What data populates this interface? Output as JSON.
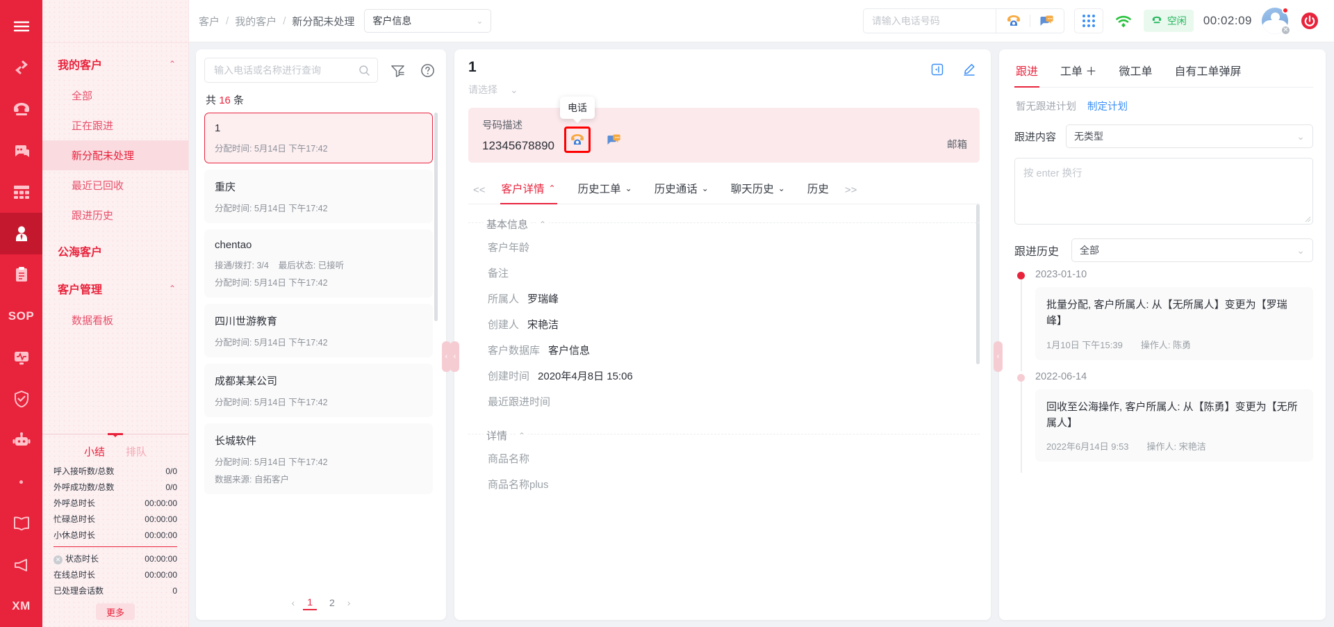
{
  "rail": {
    "items": [
      {
        "name": "menu-toggle",
        "icon": "hamburger-icon"
      },
      {
        "name": "transfer",
        "icon": "transfer-arrows-icon"
      },
      {
        "name": "telephone",
        "icon": "telephone-icon"
      },
      {
        "name": "chat",
        "icon": "chat-bubble-icon"
      },
      {
        "name": "grid",
        "icon": "grid-icon"
      },
      {
        "name": "customer",
        "icon": "person-icon"
      },
      {
        "name": "clipboard",
        "icon": "clipboard-icon"
      },
      {
        "name": "sop",
        "icon": "sop-text",
        "text": "SOP"
      },
      {
        "name": "monitor",
        "icon": "monitor-pulse-icon"
      },
      {
        "name": "shield",
        "icon": "shield-check-icon"
      },
      {
        "name": "robot",
        "icon": "robot-icon"
      },
      {
        "name": "dot",
        "icon": "dot-icon"
      },
      {
        "name": "book",
        "icon": "book-icon"
      },
      {
        "name": "megaphone",
        "icon": "megaphone-icon"
      },
      {
        "name": "xm",
        "icon": "xm-text",
        "text": "XM"
      }
    ]
  },
  "nav": {
    "groups": [
      {
        "title": "我的客户",
        "items": [
          "全部",
          "正在跟进",
          "新分配未处理",
          "最近已回收",
          "跟进历史"
        ],
        "selected": "新分配未处理"
      },
      {
        "title": "公海客户",
        "items": []
      },
      {
        "title": "客户管理",
        "items": [
          "数据看板"
        ]
      }
    ]
  },
  "stats": {
    "tabs": [
      "小结",
      "排队"
    ],
    "active_tab": "小结",
    "rows": [
      {
        "label": "呼入接听数/总数",
        "value": "0/0"
      },
      {
        "label": "外呼成功数/总数",
        "value": "0/0"
      },
      {
        "label": "外呼总时长",
        "value": "00:00:00"
      },
      {
        "label": "忙碌总时长",
        "value": "00:00:00"
      },
      {
        "label": "小休总时长",
        "value": "00:00:00"
      }
    ],
    "rows2": [
      {
        "label": "状态时长",
        "value": "00:00:00",
        "has_icon": true
      },
      {
        "label": "在线总时长",
        "value": "00:00:00",
        "has_icon": false
      },
      {
        "label": "已处理会话数",
        "value": "0",
        "has_icon": false
      }
    ],
    "more_label": "更多"
  },
  "header": {
    "breadcrumb": [
      "客户",
      "我的客户",
      "新分配未处理"
    ],
    "database_select": "客户信息",
    "phone_placeholder": "请输入电话号码",
    "phone_value": "",
    "status_label": "空闲",
    "timer": "00:02:09"
  },
  "list_panel": {
    "search_placeholder": "输入电话或名称进行查询",
    "count_prefix": "共",
    "count": "16",
    "count_suffix": "条",
    "items": [
      {
        "name": "1",
        "assigned_label": "分配时间:",
        "assigned": "5月14日 下午17:42",
        "active": true
      },
      {
        "name": "重庆",
        "assigned_label": "分配时间:",
        "assigned": "5月14日 下午17:42"
      },
      {
        "name": "chentao",
        "connect_label": "接通/拨打:",
        "connect": "3/4",
        "last_label": "最后状态:",
        "last": "已接听",
        "assigned_label": "分配时间:",
        "assigned": "5月14日 下午17:42"
      },
      {
        "name": "四川世游教育",
        "assigned_label": "分配时间:",
        "assigned": "5月14日 下午17:42"
      },
      {
        "name": "成都某某公司",
        "assigned_label": "分配时间:",
        "assigned": "5月14日 下午17:42"
      },
      {
        "name": "长城软件",
        "assigned_label": "分配时间:",
        "assigned": "5月14日 下午17:42",
        "source_label": "数据来源:",
        "source": "自拓客户"
      }
    ],
    "pages": [
      "1",
      "2"
    ],
    "current_page": "1"
  },
  "detail": {
    "title": "1",
    "select_placeholder": "请选择",
    "number_desc_label": "号码描述",
    "number": "12345678890",
    "email_label": "邮箱",
    "tooltip": "电话",
    "tabs": [
      {
        "label": "客户详情",
        "active": true
      },
      {
        "label": "历史工单",
        "active": false
      },
      {
        "label": "历史通话",
        "active": false
      },
      {
        "label": "聊天历史",
        "active": false
      },
      {
        "label": "历史",
        "active": false
      }
    ],
    "prev_arrow": "<<",
    "next_arrow": ">>",
    "sections": [
      {
        "title": "基本信息",
        "fields": [
          {
            "key": "客户年龄",
            "value": ""
          },
          {
            "key": "备注",
            "value": ""
          },
          {
            "key": "所属人",
            "value": "罗瑞峰"
          },
          {
            "key": "创建人",
            "value": "宋艳洁"
          },
          {
            "key": "客户数据库",
            "value": "客户信息"
          },
          {
            "key": "创建时间",
            "value": "2020年4月8日 15:06"
          },
          {
            "key": "最近跟进时间",
            "value": ""
          }
        ]
      },
      {
        "title": "详情",
        "fields": [
          {
            "key": "商品名称",
            "value": ""
          },
          {
            "key": "商品名称plus",
            "value": ""
          }
        ]
      }
    ]
  },
  "follow": {
    "tabs": [
      {
        "label": "跟进",
        "active": true
      },
      {
        "label": "工单 ＋",
        "active": false
      },
      {
        "label": "微工单",
        "active": false
      },
      {
        "label": "自有工单弹屏",
        "active": false
      }
    ],
    "no_plan": "暂无跟进计划",
    "make_plan": "制定计划",
    "content_label": "跟进内容",
    "type_select": "无类型",
    "textarea_placeholder": "按 enter 换行",
    "history_label": "跟进历史",
    "history_filter": "全部",
    "timeline": [
      {
        "date": "2023-01-10",
        "text": "批量分配, 客户所属人: 从【无所属人】变更为【罗瑞峰】",
        "time": "1月10日 下午15:39",
        "operator_label": "操作人:",
        "operator": "陈勇",
        "dot": "red"
      },
      {
        "date": "2022-06-14",
        "text": "回收至公海操作, 客户所属人: 从【陈勇】变更为【无所属人】",
        "time": "2022年6月14日 9:53",
        "operator_label": "操作人:",
        "operator": "宋艳洁",
        "dot": "pale"
      }
    ]
  },
  "colors": {
    "brand": "#e8233c",
    "brand_dark": "#c4182e",
    "nav_bg": "#fdf0f1",
    "link_blue": "#3a8ef6",
    "status_green": "#23b55d"
  }
}
